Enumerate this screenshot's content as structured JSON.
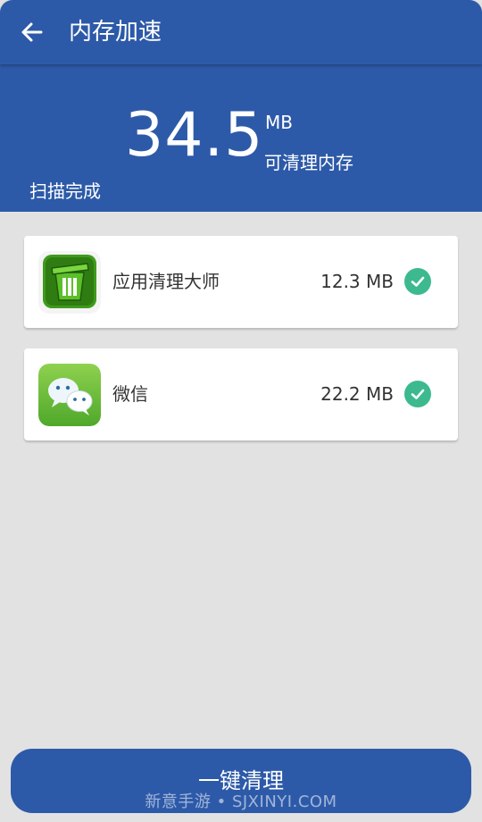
{
  "appbar": {
    "title": "内存加速",
    "back_icon": "arrow-left-icon"
  },
  "summary": {
    "amount": "34.5",
    "unit": "MB",
    "caption": "可清理内存",
    "status": "扫描完成"
  },
  "apps": [
    {
      "name": "应用清理大师",
      "size": "12.3 MB",
      "icon": "trash-bin-icon",
      "checked": true
    },
    {
      "name": "微信",
      "size": "22.2 MB",
      "icon": "wechat-icon",
      "checked": true
    }
  ],
  "actions": {
    "clean_label": "一键清理"
  },
  "watermark": "新意手游 • SJXINYI.COM",
  "colors": {
    "primary": "#2d5aa8",
    "background": "#e2e2e2",
    "check": "#3cba8e",
    "cleaner_icon": "#3f9a1c",
    "wechat_icon": "#6fbf3c"
  }
}
